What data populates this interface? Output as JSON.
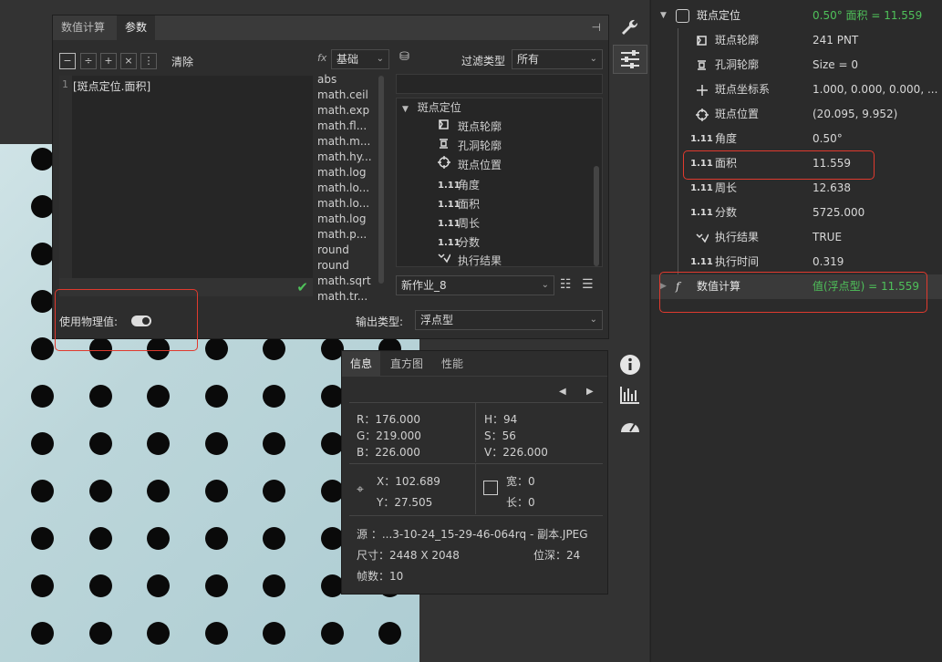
{
  "dialog": {
    "tabs": [
      "数值计算",
      "参数"
    ],
    "active_tab": "参数",
    "toolbar": {
      "ops": [
        "−",
        "÷",
        "+",
        "×",
        "⋮"
      ],
      "clear_label": "清除"
    },
    "editor": {
      "line_number": "1",
      "expression": "[斑点定位.面积]"
    },
    "fx_category": "基础",
    "functions": [
      "abs",
      "math.ceil",
      "math.exp",
      "math.fl...",
      "math.m...",
      "math.hy...",
      "math.log",
      "math.lo...",
      "math.lo...",
      "math.log",
      "math.p...",
      "round",
      "round",
      "math.sqrt",
      "math.tr..."
    ],
    "filter_label": "过滤类型",
    "filter_value": "所有",
    "tree": {
      "root": "斑点定位",
      "children": [
        {
          "icon": "contour-icon",
          "label": "斑点轮廓"
        },
        {
          "icon": "hole-contour-icon",
          "label": "孔洞轮廓"
        },
        {
          "icon": "crosshair-icon",
          "label": "斑点位置"
        },
        {
          "icon": "number-icon",
          "badge": "1.11",
          "label": "角度"
        },
        {
          "icon": "number-icon",
          "badge": "1.11",
          "label": "面积"
        },
        {
          "icon": "number-icon",
          "badge": "1.11",
          "label": "周长"
        },
        {
          "icon": "number-icon",
          "badge": "1.11",
          "label": "分数"
        },
        {
          "icon": "result-icon",
          "label": "执行结果"
        }
      ]
    },
    "job_select": "新作业_8",
    "physical_label": "使用物理值:",
    "physical_on": true,
    "output_type_label": "输出类型:",
    "output_type": "浮点型"
  },
  "info": {
    "tabs": [
      "信息",
      "直方图",
      "性能"
    ],
    "active_tab": "信息",
    "rgb": {
      "r": "R：176.000",
      "g": "G：219.000",
      "b": "B：226.000"
    },
    "hsv": {
      "h": "H：94",
      "s": "S：56",
      "v": "V：226.000"
    },
    "xy": {
      "x": "X：102.689",
      "y": "Y：27.505"
    },
    "size": {
      "w": "宽：0",
      "h": "长：0"
    },
    "source": "源  ：...3-10-24_15-29-46-064rq - 副本.JPEG",
    "dimensions": "尺寸：2448 X 2048",
    "bit_depth": "位深：24",
    "frames": "帧数：10"
  },
  "right_panel": {
    "root": {
      "label": "斑点定位",
      "value": "0.50° 面积 = 11.559"
    },
    "rows": [
      {
        "icon": "contour-icon",
        "label": "斑点轮廓",
        "value": "241 PNT"
      },
      {
        "icon": "hole-contour-icon",
        "label": "孔洞轮廓",
        "value": "Size = 0"
      },
      {
        "icon": "axis-icon",
        "label": "斑点坐标系",
        "value": "1.000, 0.000, 0.000, ..."
      },
      {
        "icon": "crosshair-icon",
        "label": "斑点位置",
        "value": "(20.095, 9.952)"
      },
      {
        "icon": "number-icon",
        "badge": "1.11",
        "label": "角度",
        "value": "0.50°"
      },
      {
        "icon": "number-icon",
        "badge": "1.11",
        "label": "面积",
        "value": "11.559"
      },
      {
        "icon": "number-icon",
        "badge": "1.11",
        "label": "周长",
        "value": "12.638"
      },
      {
        "icon": "number-icon",
        "badge": "1.11",
        "label": "分数",
        "value": "5725.000"
      },
      {
        "icon": "result-icon",
        "label": "执行结果",
        "value": "TRUE"
      },
      {
        "icon": "number-icon",
        "badge": "1.11",
        "label": "执行时间",
        "value": "0.319"
      }
    ],
    "calc": {
      "label": "数值计算",
      "value": "值(浮点型) = 11.559"
    }
  },
  "colors": {
    "accent_green": "#4fc15a",
    "highlight_red": "#e03a2e",
    "panel_bg": "#2b2b2b"
  }
}
